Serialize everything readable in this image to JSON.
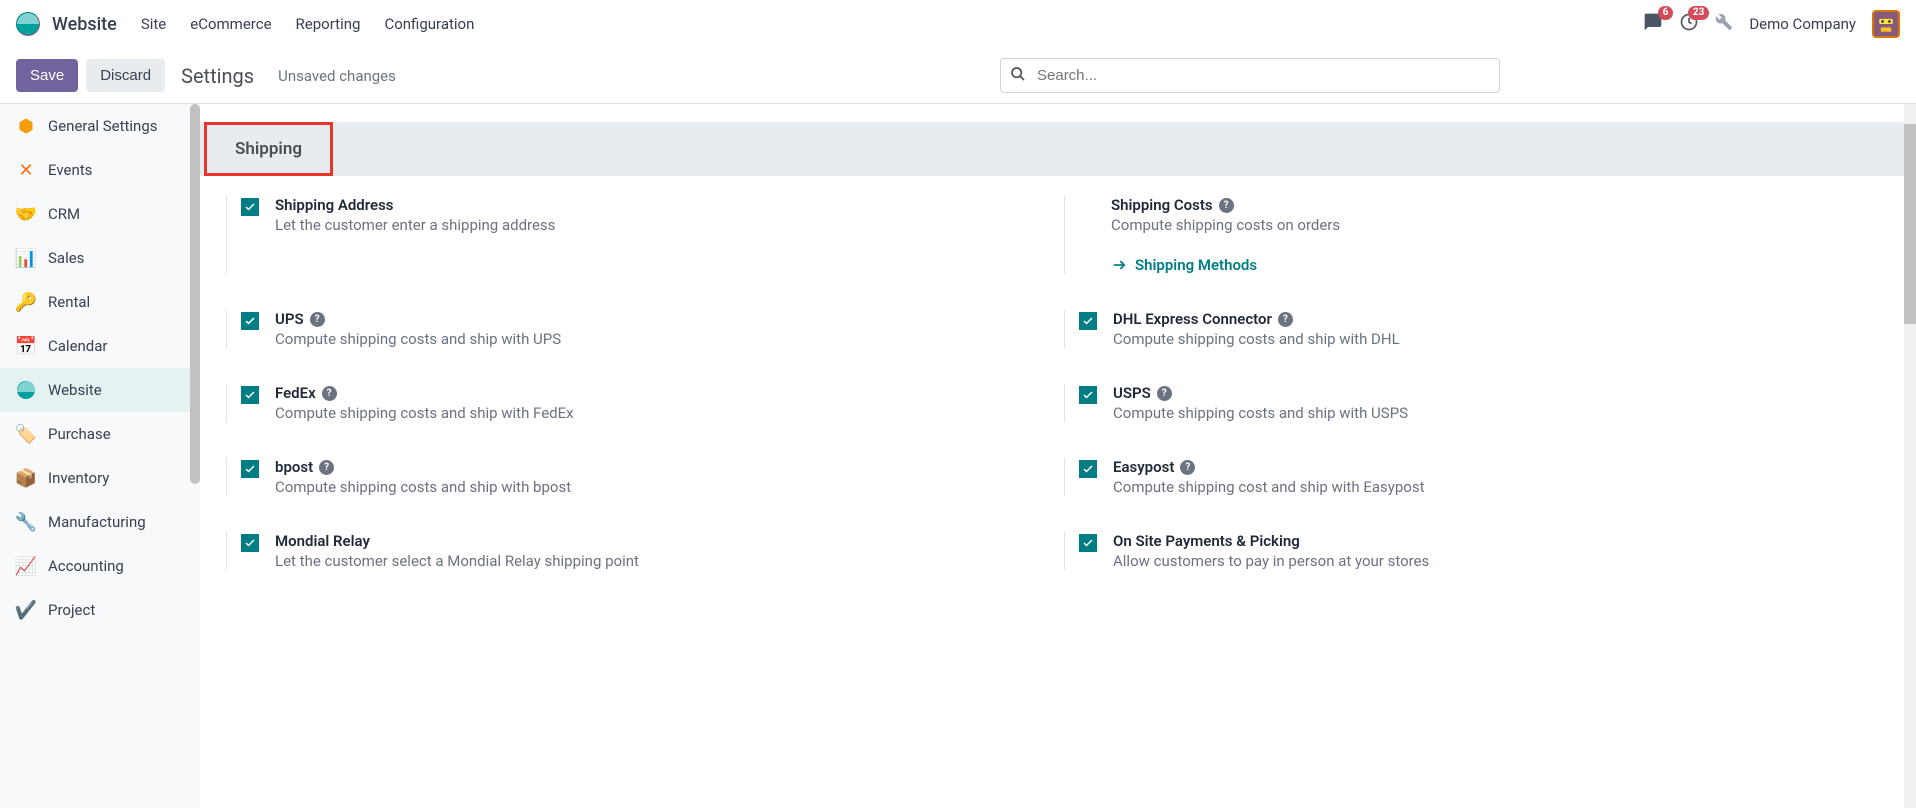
{
  "nav": {
    "app": "Website",
    "menu": [
      "Site",
      "eCommerce",
      "Reporting",
      "Configuration"
    ],
    "messages_badge": "6",
    "activities_badge": "23",
    "company": "Demo Company"
  },
  "controlbar": {
    "save": "Save",
    "discard": "Discard",
    "title": "Settings",
    "unsaved": "Unsaved changes",
    "search_placeholder": "Search..."
  },
  "sidebar": {
    "items": [
      {
        "label": "General Settings"
      },
      {
        "label": "Events"
      },
      {
        "label": "CRM"
      },
      {
        "label": "Sales"
      },
      {
        "label": "Rental"
      },
      {
        "label": "Calendar"
      },
      {
        "label": "Website"
      },
      {
        "label": "Purchase"
      },
      {
        "label": "Inventory"
      },
      {
        "label": "Manufacturing"
      },
      {
        "label": "Accounting"
      },
      {
        "label": "Project"
      }
    ]
  },
  "section": {
    "title": "Shipping"
  },
  "settings": {
    "shipping_address": {
      "title": "Shipping Address",
      "desc": "Let the customer enter a shipping address"
    },
    "shipping_costs": {
      "title": "Shipping Costs",
      "desc": "Compute shipping costs on orders",
      "link": "Shipping Methods"
    },
    "ups": {
      "title": "UPS",
      "desc": "Compute shipping costs and ship with UPS"
    },
    "dhl": {
      "title": "DHL Express Connector",
      "desc": "Compute shipping costs and ship with DHL"
    },
    "fedex": {
      "title": "FedEx",
      "desc": "Compute shipping costs and ship with FedEx"
    },
    "usps": {
      "title": "USPS",
      "desc": "Compute shipping costs and ship with USPS"
    },
    "bpost": {
      "title": "bpost",
      "desc": "Compute shipping costs and ship with bpost"
    },
    "easypost": {
      "title": "Easypost",
      "desc": "Compute shipping cost and ship with Easypost"
    },
    "mondial": {
      "title": "Mondial Relay",
      "desc": "Let the customer select a Mondial Relay shipping point"
    },
    "onsite": {
      "title": "On Site Payments & Picking",
      "desc": "Allow customers to pay in person at your stores"
    }
  }
}
